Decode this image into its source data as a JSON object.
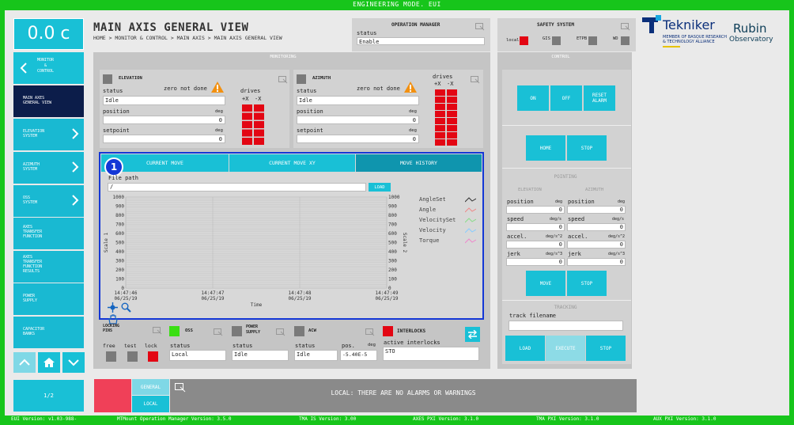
{
  "mode_banner": "ENGINEERING MODE. EUI",
  "timer": "0.0 c",
  "nav": {
    "back_label": "MONITOR\n&\nCONTROL",
    "items": [
      {
        "label": "MAIN AXES\nGENERAL VIEW"
      },
      {
        "label": "ELEVATION\nSYSTEM"
      },
      {
        "label": "AZIMUTH\nSYSTEM"
      },
      {
        "label": "OSS\nSYSTEM"
      },
      {
        "label": "AXES\nTRANSFER\nFUNCTION"
      },
      {
        "label": "AXES\nTRANSFER\nFUNCTION\nRESULTS"
      },
      {
        "label": "POWER\nSUPPLY"
      },
      {
        "label": "CAPACITOR\nBANKS"
      }
    ],
    "page": "1/2"
  },
  "header": {
    "title": "MAIN AXIS GENERAL VIEW",
    "breadcrumb": "HOME > MONITOR & CONTROL > MAIN AXIS > MAIN AXIS GENERAL VIEW"
  },
  "operation_manager": {
    "title": "OPERATION MANAGER",
    "status_label": "status",
    "status_value": "Enable"
  },
  "safety": {
    "title": "SAFETY SYSTEM",
    "local": "local",
    "gis": "GIS",
    "etpb": "ETPB",
    "wd": "WD"
  },
  "logos": {
    "tekniker": "Tekniker",
    "tekniker_sub": "MEMBER OF BASQUE RESEARCH\n& TECHNOLOGY ALLIANCE",
    "rubin1": "Rubin",
    "rubin2": "Observatory"
  },
  "monitoring": {
    "title": "MONITORING",
    "elevation": {
      "title": "ELEVATION",
      "status_label": "status",
      "zero": "zero not done",
      "status": "Idle",
      "position_label": "position",
      "position_unit": "deg",
      "position": "0",
      "setpoint_label": "setpoint",
      "setpoint_unit": "deg",
      "setpoint": "0",
      "drives": "drives",
      "px": "+X",
      "mx": "-X"
    },
    "azimuth": {
      "title": "AZIMUTH",
      "status_label": "status",
      "zero": "zero not done",
      "status": "Idle",
      "position_label": "position",
      "position_unit": "deg",
      "position": "0",
      "setpoint_label": "setpoint",
      "setpoint_unit": "deg",
      "setpoint": "0",
      "drives": "drives",
      "px": "+X",
      "mx": "-X"
    },
    "tabs": [
      "CURRENT MOVE",
      "CURRENT MOVE XY",
      "MOVE HISTORY"
    ],
    "marker": "1",
    "file_path_label": "File path",
    "file_path_value": "/",
    "load_label": "LOAD",
    "time_label": "Time",
    "scale1": "Scale 1",
    "scale2": "Scale 2",
    "legend": [
      "AngleSet",
      "Angle",
      "VelocitySet",
      "Velocity",
      "Torque"
    ]
  },
  "chart_data": {
    "type": "line",
    "xlabel": "Time",
    "ylabel": "Scale 1",
    "y2label": "Scale 2",
    "ylim": [
      0,
      1000
    ],
    "y_ticks": [
      "1000",
      "900",
      "800",
      "700",
      "600",
      "500",
      "400",
      "300",
      "200",
      "100",
      "0"
    ],
    "x_ticks": [
      [
        "14:47:46",
        "06/25/19"
      ],
      [
        "14:47:47",
        "06/25/19"
      ],
      [
        "14:47:48",
        "06/25/19"
      ],
      [
        "14:47:49",
        "06/25/19"
      ]
    ],
    "series": [
      {
        "name": "AngleSet",
        "color": "#333333",
        "values": []
      },
      {
        "name": "Angle",
        "color": "#e88",
        "values": []
      },
      {
        "name": "VelocitySet",
        "color": "#8d8",
        "values": []
      },
      {
        "name": "Velocity",
        "color": "#8cf",
        "values": []
      },
      {
        "name": "Torque",
        "color": "#e8c",
        "values": []
      }
    ],
    "grid": true,
    "legend": "right"
  },
  "bottom": {
    "locking": {
      "title": "LOCKING\nPINS",
      "free": "free",
      "test": "test",
      "lock": "lock"
    },
    "oss": {
      "title": "OSS",
      "status_label": "status",
      "status": "Local"
    },
    "power": {
      "title": "POWER\nSUPPLY",
      "status_label": "status",
      "status": "Idle"
    },
    "acw": {
      "title": "ACW",
      "status_label": "status",
      "status": "Idle",
      "pos_label": "pos.",
      "pos_unit": "deg",
      "pos": "-5.40E-5"
    },
    "interlocks": {
      "title": "INTERLOCKS",
      "active_label": "active interlocks",
      "active": "STO"
    }
  },
  "control": {
    "title": "CONTROL",
    "on": "ON",
    "off": "OFF",
    "reset": "RESET\nALARM",
    "home": "HOME",
    "stop": "STOP",
    "pointing": "POINTING",
    "elevation": "ELEVATION",
    "azimuth": "AZIMUTH",
    "rows": [
      {
        "label": "position",
        "unit": "deg",
        "el": "0",
        "az": "0"
      },
      {
        "label": "speed",
        "unit": "deg/s",
        "el": "0",
        "az": "0"
      },
      {
        "label": "accel.",
        "unit": "deg/s^2",
        "el": "0",
        "az": "0"
      },
      {
        "label": "jerk",
        "unit": "deg/s^3",
        "el": "0",
        "az": "0"
      }
    ],
    "move": "MOVE",
    "stop2": "STOP",
    "tracking": "TRACKING",
    "track_label": "track filename",
    "load": "LOAD",
    "execute": "EXECUTE",
    "stop3": "STOP"
  },
  "alarm": {
    "general": "GENERAL",
    "local": "LOCAL",
    "message": "LOCAL: THERE ARE NO ALARMS OR WARNINGS"
  },
  "footer": [
    "EUI Version: v1.03-988-",
    "MTMount Operation Manager Version: 3.5.0",
    "TMA IS Version: 3.00",
    "AXES PXI Version: 3.1.0",
    "TMA PXI Version: 3.1.0",
    "AUX PXI Version: 3.1.0"
  ]
}
